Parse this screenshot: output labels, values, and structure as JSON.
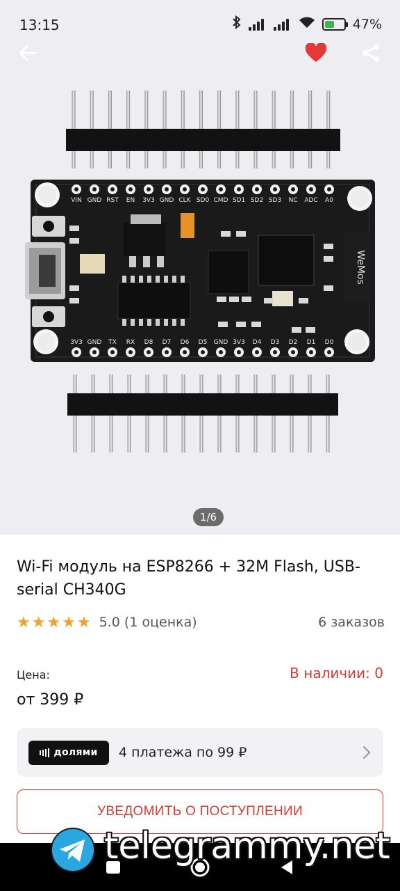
{
  "status_bar": {
    "time": "13:15",
    "battery": "47%",
    "icons": [
      "bluetooth-icon",
      "signal-icon",
      "signal-icon",
      "wifi-icon",
      "battery-charging-icon"
    ]
  },
  "top_bar": {
    "icons": [
      "back-arrow-icon",
      "heart-icon",
      "share-icon"
    ],
    "favorite_color": "#e53935"
  },
  "gallery": {
    "counter": "1/6",
    "pin_labels_top": [
      "VIN",
      "GND",
      "RST",
      "EN",
      "3V3",
      "GND",
      "CLK",
      "SD0",
      "CMD",
      "SD1",
      "SD2",
      "SD3",
      "NC",
      "ADC",
      "A0"
    ],
    "pin_labels_bottom": [
      "3V3",
      "GND",
      "TX",
      "RX",
      "D8",
      "D7",
      "D6",
      "D5",
      "GND",
      "3V3",
      "D4",
      "D3",
      "D2",
      "D1",
      "D0"
    ]
  },
  "product": {
    "title": "Wi-Fi модуль на ESP8266 + 32M Flash, USB-serial CH340G",
    "rating_stars": 5,
    "rating_text": "5.0 (1 оценка)",
    "orders": "6 заказов",
    "price_label": "Цена:",
    "price": "от 399 ₽",
    "stock": "В наличии: 0"
  },
  "installments": {
    "badge": "долями",
    "text": "4 платежа по 99 ₽"
  },
  "notify_button": {
    "label": "УВЕДОМИТЬ О ПОСТУПЛЕНИИ"
  },
  "watermark": {
    "text": "telegrammy.net"
  },
  "colors": {
    "accent_red": "#d43a32",
    "star": "#f0a128",
    "badge_bg": "#111111"
  }
}
